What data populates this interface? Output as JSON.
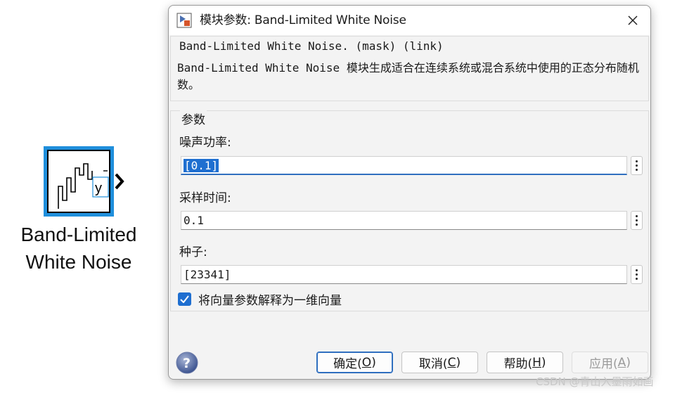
{
  "block": {
    "icon_label": "y",
    "name_line1": "Band-Limited",
    "name_line2": "White Noise"
  },
  "dialog": {
    "title": "模块参数: Band-Limited White Noise",
    "description_title": "Band-Limited White Noise. (mask) (link)",
    "description_text": "Band-Limited White Noise 模块生成适合在连续系统或混合系统中使用的正态分布随机数。",
    "params_group_title": "参数",
    "fields": [
      {
        "label": "噪声功率:",
        "value": "[0.1]"
      },
      {
        "label": "采样时间:",
        "value": "0.1"
      },
      {
        "label": "种子:",
        "value": "[23341]"
      }
    ],
    "checkbox": {
      "label": "将向量参数解释为一维向量",
      "checked": true
    },
    "buttons": {
      "ok": {
        "text": "确定(",
        "key": "O",
        "end": ")"
      },
      "cancel": {
        "text": "取消(",
        "key": "C",
        "end": ")"
      },
      "help": {
        "text": "帮助(",
        "key": "H",
        "end": ")"
      },
      "apply": {
        "text": "应用(",
        "key": "A",
        "end": ")"
      }
    }
  },
  "watermark": "CSDN @青山入墨雨如画",
  "colors": {
    "accent": "#1f6fd0",
    "block_border": "#1f8fdc"
  }
}
